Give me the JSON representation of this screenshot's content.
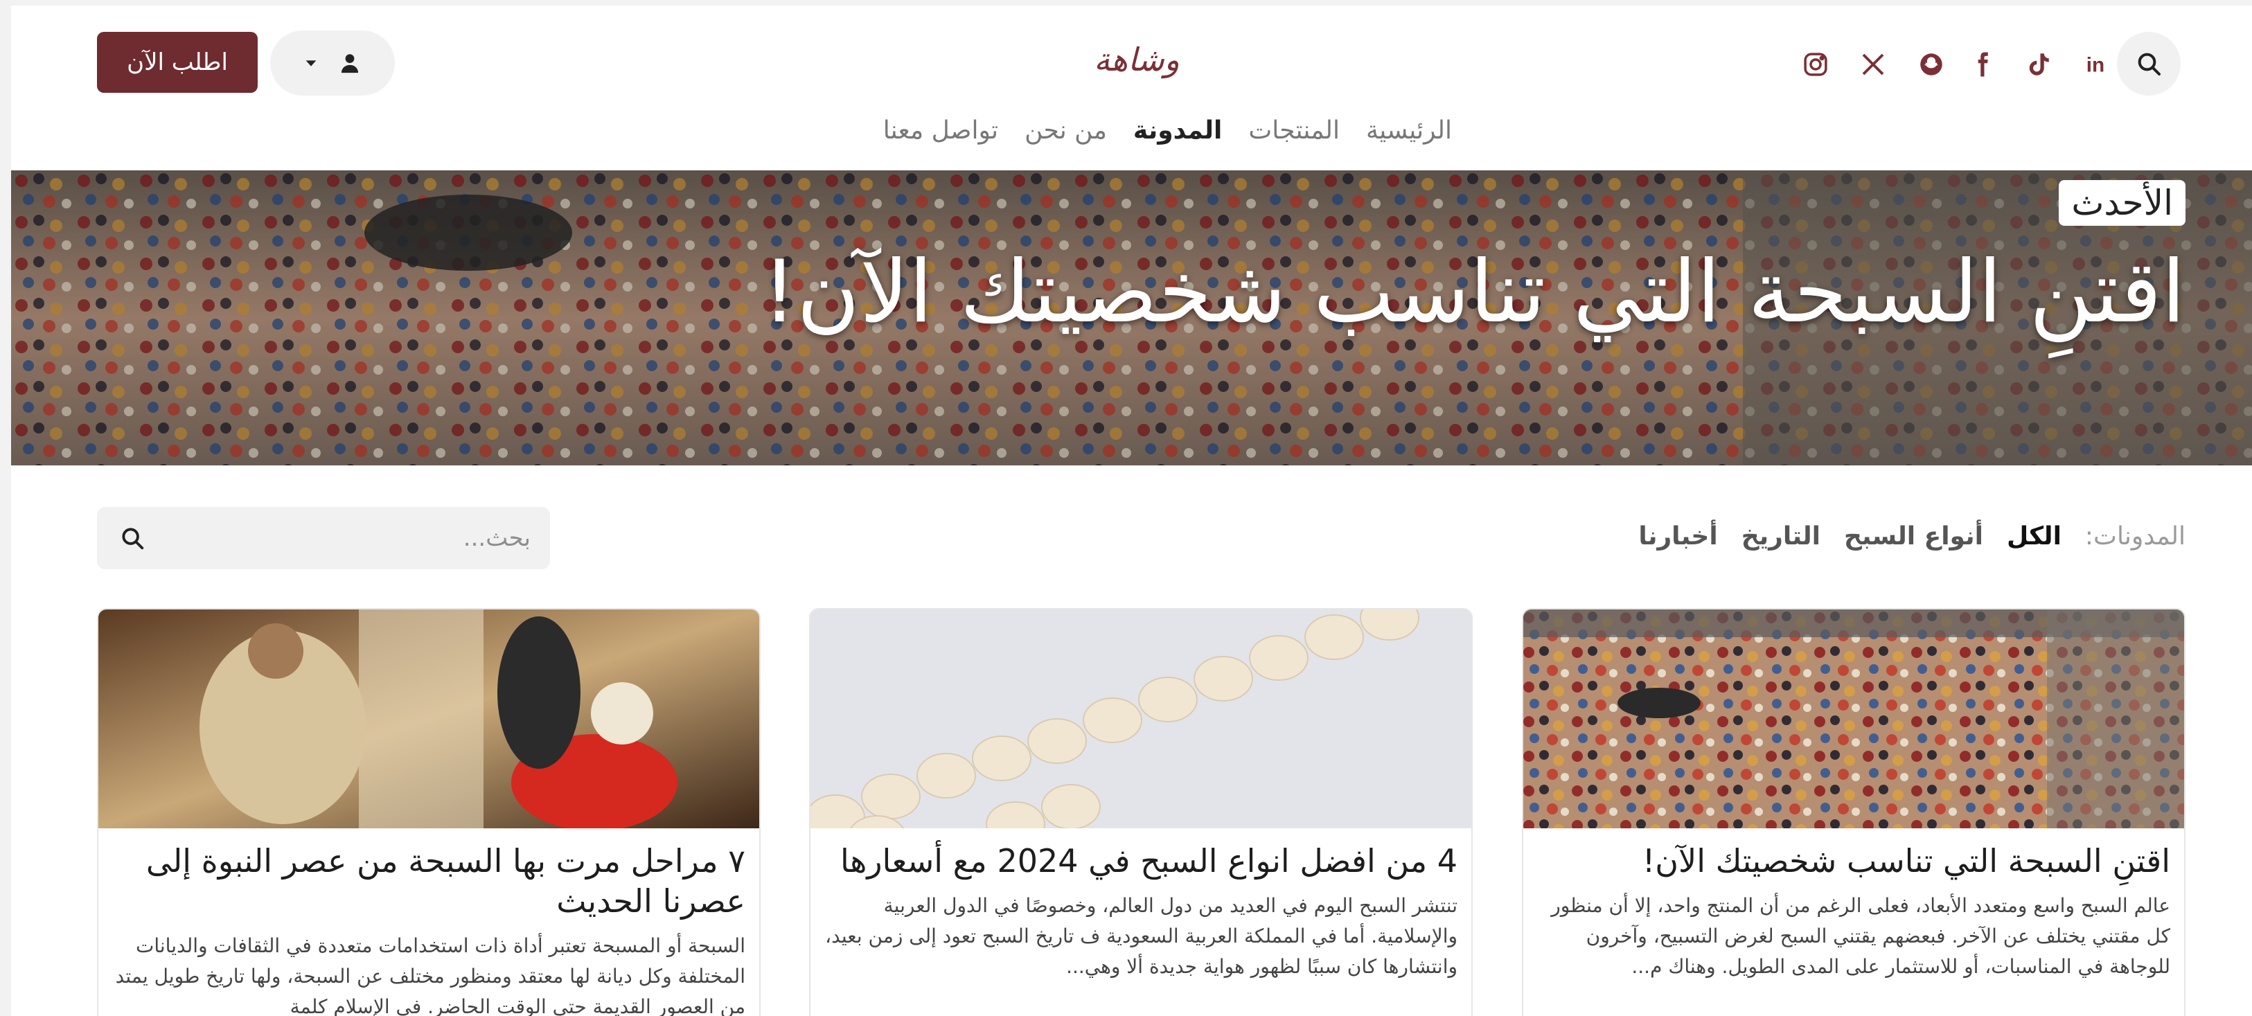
{
  "header": {
    "order_button": "اطلب الآن",
    "logo_text": "وشاهة",
    "social": [
      "search-icon",
      "instagram-icon",
      "x-icon",
      "snapchat-icon",
      "facebook-icon",
      "tiktok-icon",
      "linkedin-icon"
    ],
    "nav": [
      "الرئيسية",
      "المنتجات",
      "المدونة",
      "من نحن",
      "تواصل معنا"
    ],
    "nav_active": "المدونة"
  },
  "hero": {
    "badge": "الأحدث",
    "title": "اقتنِ السبحة التي تناسب شخصيتك الآن!"
  },
  "filters": {
    "label": "المدونات:",
    "chips": [
      "الكل",
      "أنواع السبح",
      "التاريخ",
      "أخبارنا"
    ],
    "active": "الكل"
  },
  "search": {
    "placeholder": "بحث..."
  },
  "cards": [
    {
      "title": "اقتنِ السبحة التي تناسب شخصيتك الآن!",
      "excerpt": "عالم السبح واسع ومتعدد الأبعاد، فعلى الرغم من أن المنتج واحد، إلا أن منظور كل مقتني يختلف عن الآخر. فبعضهم يقتني السبح لغرض التسبيح، وآخرون للوجاهة في المناسبات، أو للاستثمار على المدى الطويل. وهناك م..."
    },
    {
      "title": "4 من افضل انواع السبح في 2024 مع أسعارها",
      "excerpt": "تنتشر السبح اليوم في العديد من دول العالم، وخصوصًا في الدول العربية والإسلامية. أما في المملكة العربية السعودية ف   تاريخ السبح   تعود إلى زمن بعيد، وانتشارها كان سببًا لظهور هواية جديدة ألا وهي..."
    },
    {
      "title": "٧ مراحل مرت بها السبحة من عصر النبوة إلى عصرنا الحديث",
      "excerpt": "السبحة أو المسبحة تعتبر أداة ذات استخدامات متعددة في الثقافات والديانات المختلفة وكل ديانة لها معتقد ومنظور مختلف عن السبحة، ولها تاريخ طويل يمتد من العصور القديمة حتى الوقت الحاضر. في الإسلام كلمة"
    }
  ],
  "colors": {
    "brand": "#6e2b30",
    "pill_bg": "#f1f1f1"
  }
}
